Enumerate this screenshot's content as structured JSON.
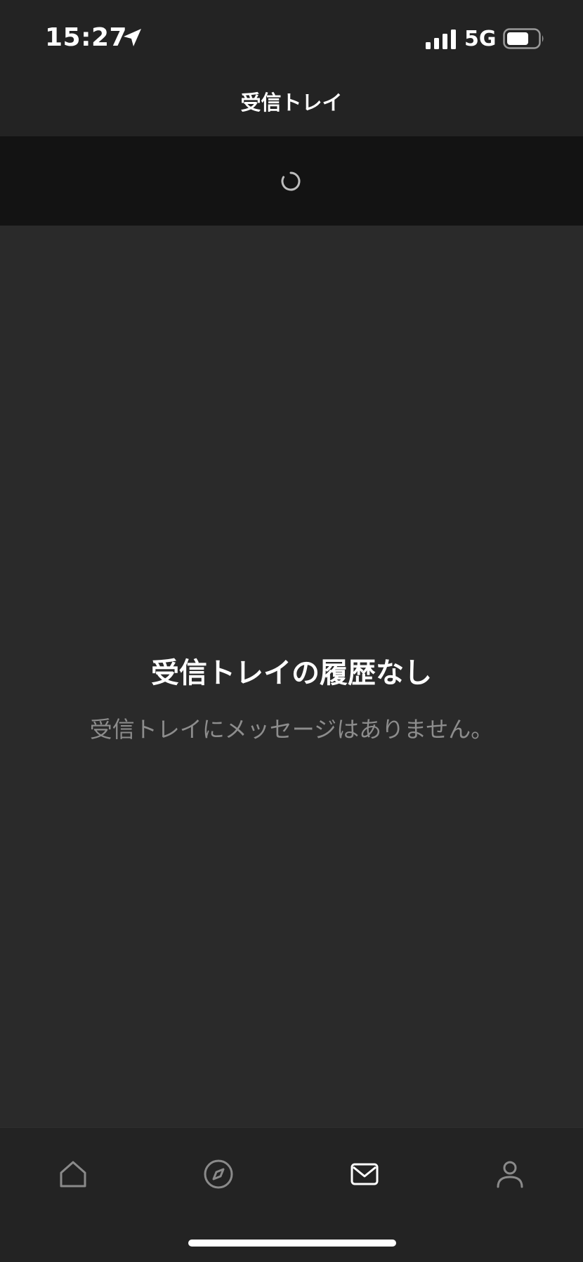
{
  "status_bar": {
    "time": "15:27",
    "network": "5G",
    "icons": [
      "location-arrow-icon",
      "cellular-signal-icon",
      "battery-icon"
    ]
  },
  "header": {
    "title": "受信トレイ"
  },
  "refresh": {
    "icon": "loading-spinner-icon"
  },
  "empty_state": {
    "title": "受信トレイの履歴なし",
    "message": "受信トレイにメッセージはありません。"
  },
  "tab_bar": {
    "items": [
      {
        "icon": "home-icon",
        "active": false
      },
      {
        "icon": "compass-icon",
        "active": false
      },
      {
        "icon": "mail-icon",
        "active": true
      },
      {
        "icon": "profile-icon",
        "active": false
      }
    ]
  },
  "colors": {
    "background": "#2a2a2a",
    "bars": "#232323",
    "refresh_area": "#131313",
    "primary_text": "#ffffff",
    "secondary_text": "#8d8d8d",
    "inactive_icon": "#8a8a8a",
    "active_icon": "#ffffff"
  }
}
